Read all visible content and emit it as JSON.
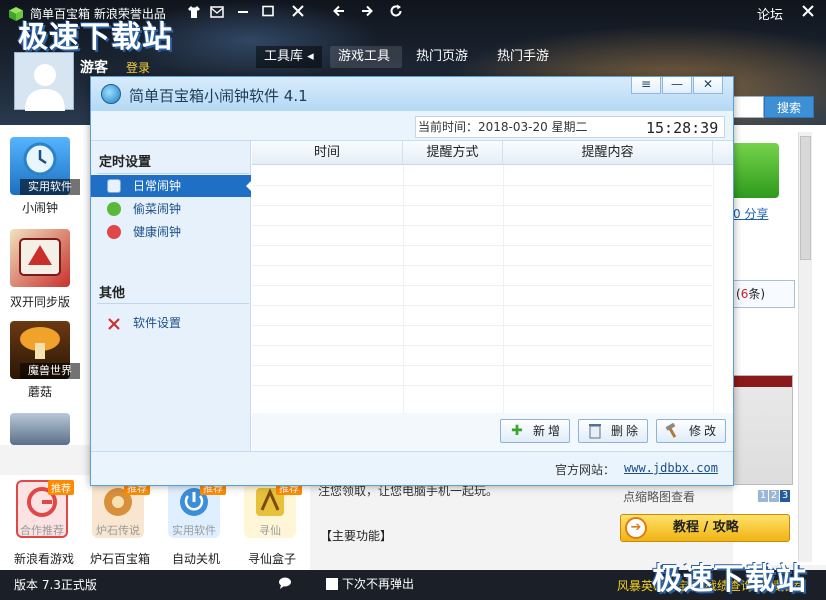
{
  "main": {
    "title": "简单百宝箱 新浪荣誉出品",
    "forum": "论坛",
    "watermark": "极速下载站",
    "user": {
      "name": "游客",
      "login": "登录"
    },
    "tabs": [
      "工具库",
      "游戏工具",
      "热门页游",
      "热门手游"
    ],
    "search_label": "搜索",
    "apps": [
      {
        "icon_label": "实用软件",
        "name": "小闹钟",
        "color": "#2c7fd0"
      },
      {
        "icon_label": "",
        "name": "双开同步版",
        "color": "#c9302c"
      },
      {
        "icon_label": "魔兽世界",
        "name": "蘑菇",
        "color": "#d48a14"
      },
      {
        "icon_label": "",
        "name": "",
        "color": "#8fa3b8"
      }
    ],
    "right": {
      "share": "0 分享",
      "count_prefix": "(",
      "count_value": "6",
      "count_suffix": "条)",
      "thumb_hint": "点缩略图查看",
      "pages": [
        "1",
        "2",
        "3"
      ],
      "guide": "教程 / 攻略"
    },
    "article": "注您领取，让您电脑手机一起玩。",
    "features_heading": "【主要功能】",
    "bottom_apps": [
      {
        "badge": "推荐",
        "caption": "合作推荐",
        "name": "新浪看游戏",
        "color": "#e04848"
      },
      {
        "badge": "推荐",
        "caption": "炉石传说",
        "name": "炉石百宝箱",
        "color": "#d8903a"
      },
      {
        "badge": "推荐",
        "caption": "实用软件",
        "name": "自动关机",
        "color": "#3a8fd8"
      },
      {
        "badge": "推荐",
        "caption": "寻仙",
        "name": "寻仙盒子",
        "color": "#e8c13a"
      }
    ],
    "status": {
      "version": "版本 7.3正式版",
      "no_popup": "下次不再弹出",
      "ticker": "风暴英雄百宝箱 战绩查询 天赋推荐"
    }
  },
  "dialog": {
    "title": "简单百宝箱小闹钟软件 4.1",
    "date_label": "当前时间：2018-03-20   星期二",
    "clock": "15:28:39",
    "nav": {
      "section1": "定时设置",
      "items1": [
        "日常闹钟",
        "偷菜闹钟",
        "健康闹钟"
      ],
      "section2": "其他",
      "items2": [
        "软件设置"
      ]
    },
    "columns": [
      "时间",
      "提醒方式",
      "提醒内容"
    ],
    "buttons": {
      "add": "新增",
      "delete": "删除",
      "edit": "修改"
    },
    "footer_label": "官方网站：",
    "footer_url": "www.jdbbx.com"
  },
  "icons": {
    "logo": "green-cube-icon",
    "shirt": "shirt-icon",
    "message": "message-icon",
    "minimize": "minimize-icon",
    "maximize": "maximize-icon",
    "close": "close-icon",
    "back": "back-arrow-icon",
    "forward": "forward-arrow-icon",
    "refresh": "refresh-icon"
  },
  "colors": {
    "accent": "#1f6fc4",
    "header": "#1b2533",
    "ticker": "#f5d321"
  }
}
